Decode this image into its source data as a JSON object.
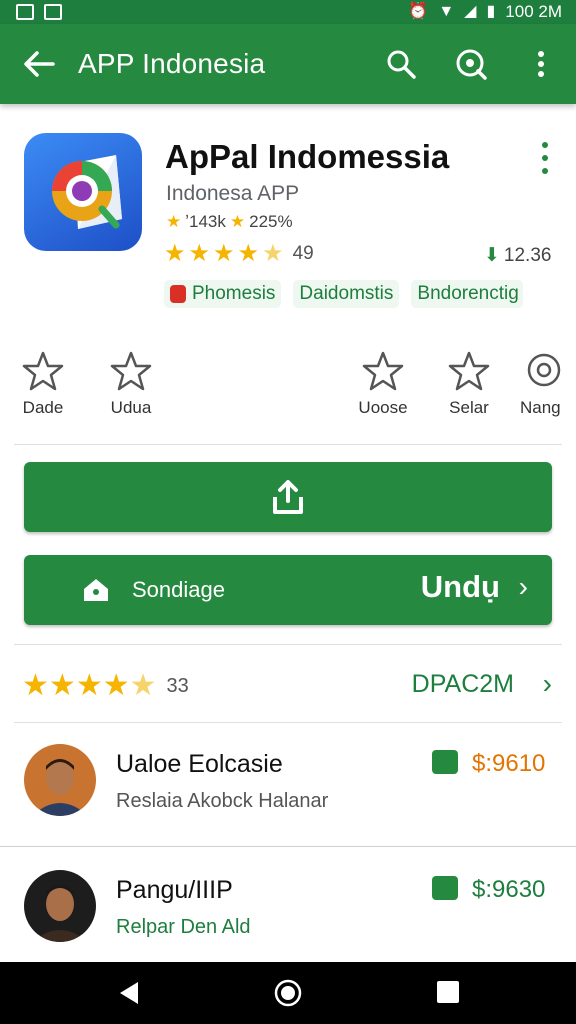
{
  "status_bar": {
    "time": "100 2M"
  },
  "app_bar": {
    "title": "APP Indonesia"
  },
  "app": {
    "name": "ApPal Indomessia",
    "developer": "Indonesa APP",
    "downloads": "⁠ʼ⁠143k",
    "rating_short": "225%",
    "rating_count": "49",
    "size": "12.36",
    "rating_value": 4.5,
    "tags": [
      {
        "label": "Phomesis"
      },
      {
        "label": "Daidomstis"
      },
      {
        "label": "Bndorenctig"
      }
    ]
  },
  "quick_actions": [
    {
      "label": "Dade"
    },
    {
      "label": "Udua"
    },
    {
      "label": "Uoose"
    },
    {
      "label": "Selar"
    },
    {
      "label": "Nang"
    }
  ],
  "install_button": {
    "left_label": "Sondiage",
    "right_label": "Undụ"
  },
  "rating_summary": {
    "count": "33",
    "total": "DPAC2M",
    "value": 4.5
  },
  "reviews": [
    {
      "name": "Ualoe Eolcasie",
      "subtitle": "Reslaia Akobck Halanar",
      "price": "$:9610",
      "price_color": "#e37400"
    },
    {
      "name": "Pangu/IIIP",
      "subtitle": "Relpar Den Ald",
      "price": "$:9630",
      "price_color": "#1e7e3e"
    }
  ],
  "colors": {
    "primary": "#25893f",
    "status_bar": "#1e7e3e",
    "star": "#f5b400",
    "price_orange": "#e37400"
  }
}
